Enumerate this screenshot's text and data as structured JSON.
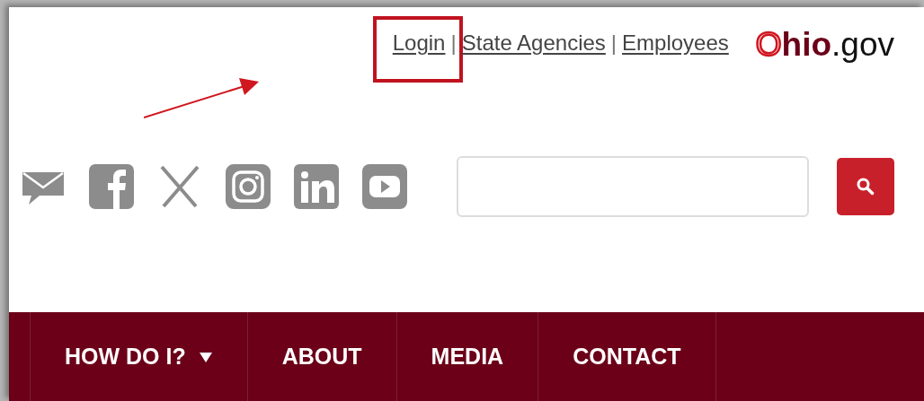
{
  "top_links": [
    {
      "kind": "link",
      "label": "Login",
      "highlighted": true
    },
    {
      "kind": "separator",
      "label": "|"
    },
    {
      "kind": "link",
      "label": "State Agencies",
      "highlighted": false
    },
    {
      "kind": "separator",
      "label": "|"
    },
    {
      "kind": "link",
      "label": "Employees",
      "highlighted": false
    }
  ],
  "logo": {
    "parts": [
      {
        "kind": "ring",
        "text": "O"
      },
      {
        "kind": "bold",
        "text": "hio"
      },
      {
        "kind": "plain",
        "text": ".gov"
      }
    ]
  },
  "social_icons": [
    {
      "kind": "mail"
    },
    {
      "kind": "facebook"
    },
    {
      "kind": "x"
    },
    {
      "kind": "instagram"
    },
    {
      "kind": "linkedin"
    },
    {
      "kind": "youtube"
    }
  ],
  "nav": [
    {
      "label": "HOW DO I?",
      "dropdown": true
    },
    {
      "label": "ABOUT",
      "dropdown": false
    },
    {
      "label": "MEDIA",
      "dropdown": false
    },
    {
      "label": "CONTACT",
      "dropdown": false
    }
  ]
}
